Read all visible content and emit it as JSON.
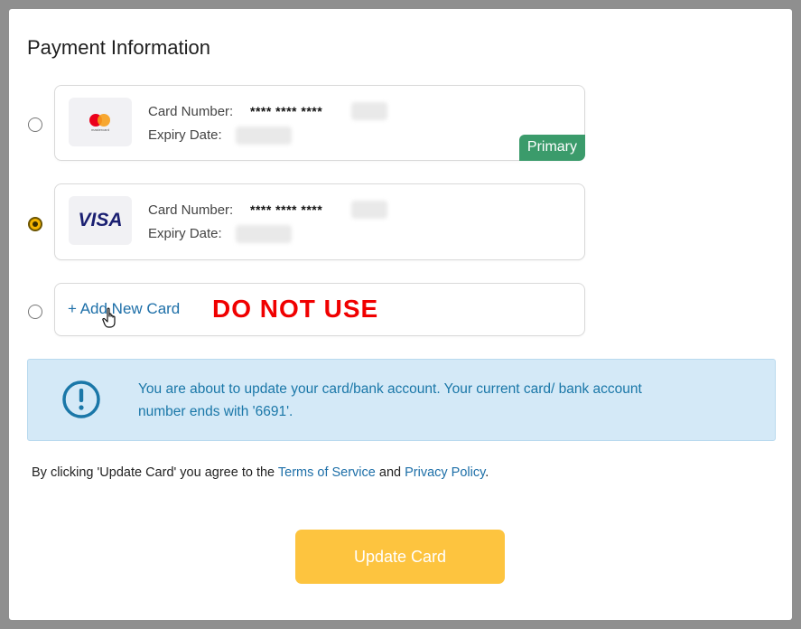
{
  "title": "Payment Information",
  "cards": [
    {
      "brand": "mastercard",
      "logo_text": "mastercard",
      "number_label": "Card Number:",
      "masked_number": "**** **** ****",
      "expiry_label": "Expiry Date:",
      "badge": "Primary",
      "selected": false
    },
    {
      "brand": "visa",
      "logo_text": "VISA",
      "number_label": "Card Number:",
      "masked_number": "**** **** ****",
      "expiry_label": "Expiry Date:",
      "selected": true
    }
  ],
  "add_card": {
    "label": "+ Add New Card",
    "warning": "DO NOT USE",
    "selected": false
  },
  "info": {
    "icon": "exclamation-circle-icon",
    "message": "You are about to update your card/bank account. Your current card/ bank account number ends with '6691'."
  },
  "terms": {
    "prefix": "By clicking 'Update Card' you agree to the ",
    "terms_link": "Terms of Service",
    "conjunction": " and ",
    "privacy_link": "Privacy Policy",
    "suffix": "."
  },
  "submit_label": "Update Card",
  "colors": {
    "accent": "#fdc43f",
    "primary_badge": "#3b9b6b",
    "link": "#1d6fa8",
    "warning": "#f00000",
    "info_bg": "#d4e9f7"
  }
}
